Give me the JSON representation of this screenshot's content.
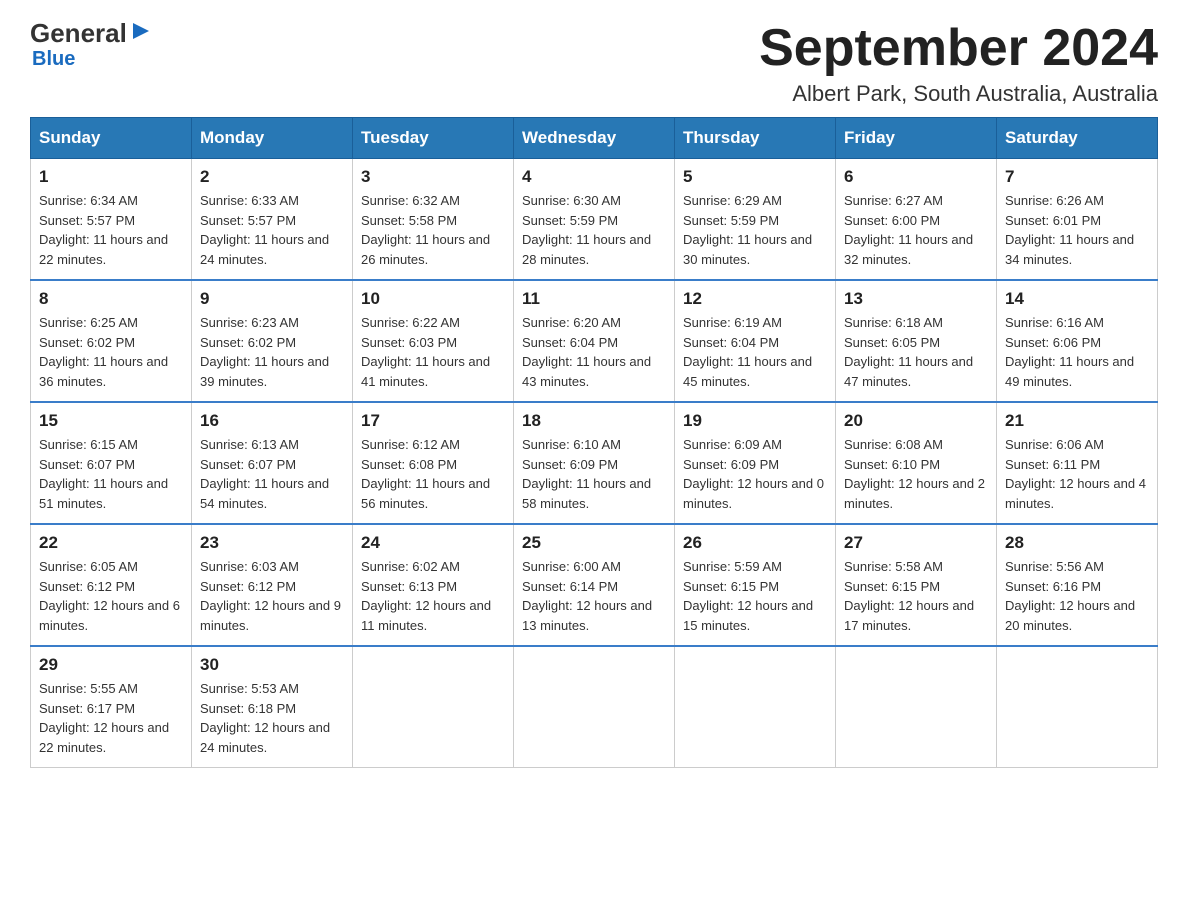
{
  "logo": {
    "general": "General",
    "blue": "Blue",
    "triangle_unicode": "▶"
  },
  "header": {
    "title": "September 2024",
    "subtitle": "Albert Park, South Australia, Australia"
  },
  "days_of_week": [
    "Sunday",
    "Monday",
    "Tuesday",
    "Wednesday",
    "Thursday",
    "Friday",
    "Saturday"
  ],
  "weeks": [
    [
      {
        "day": "1",
        "sunrise": "6:34 AM",
        "sunset": "5:57 PM",
        "daylight": "11 hours and 22 minutes."
      },
      {
        "day": "2",
        "sunrise": "6:33 AM",
        "sunset": "5:57 PM",
        "daylight": "11 hours and 24 minutes."
      },
      {
        "day": "3",
        "sunrise": "6:32 AM",
        "sunset": "5:58 PM",
        "daylight": "11 hours and 26 minutes."
      },
      {
        "day": "4",
        "sunrise": "6:30 AM",
        "sunset": "5:59 PM",
        "daylight": "11 hours and 28 minutes."
      },
      {
        "day": "5",
        "sunrise": "6:29 AM",
        "sunset": "5:59 PM",
        "daylight": "11 hours and 30 minutes."
      },
      {
        "day": "6",
        "sunrise": "6:27 AM",
        "sunset": "6:00 PM",
        "daylight": "11 hours and 32 minutes."
      },
      {
        "day": "7",
        "sunrise": "6:26 AM",
        "sunset": "6:01 PM",
        "daylight": "11 hours and 34 minutes."
      }
    ],
    [
      {
        "day": "8",
        "sunrise": "6:25 AM",
        "sunset": "6:02 PM",
        "daylight": "11 hours and 36 minutes."
      },
      {
        "day": "9",
        "sunrise": "6:23 AM",
        "sunset": "6:02 PM",
        "daylight": "11 hours and 39 minutes."
      },
      {
        "day": "10",
        "sunrise": "6:22 AM",
        "sunset": "6:03 PM",
        "daylight": "11 hours and 41 minutes."
      },
      {
        "day": "11",
        "sunrise": "6:20 AM",
        "sunset": "6:04 PM",
        "daylight": "11 hours and 43 minutes."
      },
      {
        "day": "12",
        "sunrise": "6:19 AM",
        "sunset": "6:04 PM",
        "daylight": "11 hours and 45 minutes."
      },
      {
        "day": "13",
        "sunrise": "6:18 AM",
        "sunset": "6:05 PM",
        "daylight": "11 hours and 47 minutes."
      },
      {
        "day": "14",
        "sunrise": "6:16 AM",
        "sunset": "6:06 PM",
        "daylight": "11 hours and 49 minutes."
      }
    ],
    [
      {
        "day": "15",
        "sunrise": "6:15 AM",
        "sunset": "6:07 PM",
        "daylight": "11 hours and 51 minutes."
      },
      {
        "day": "16",
        "sunrise": "6:13 AM",
        "sunset": "6:07 PM",
        "daylight": "11 hours and 54 minutes."
      },
      {
        "day": "17",
        "sunrise": "6:12 AM",
        "sunset": "6:08 PM",
        "daylight": "11 hours and 56 minutes."
      },
      {
        "day": "18",
        "sunrise": "6:10 AM",
        "sunset": "6:09 PM",
        "daylight": "11 hours and 58 minutes."
      },
      {
        "day": "19",
        "sunrise": "6:09 AM",
        "sunset": "6:09 PM",
        "daylight": "12 hours and 0 minutes."
      },
      {
        "day": "20",
        "sunrise": "6:08 AM",
        "sunset": "6:10 PM",
        "daylight": "12 hours and 2 minutes."
      },
      {
        "day": "21",
        "sunrise": "6:06 AM",
        "sunset": "6:11 PM",
        "daylight": "12 hours and 4 minutes."
      }
    ],
    [
      {
        "day": "22",
        "sunrise": "6:05 AM",
        "sunset": "6:12 PM",
        "daylight": "12 hours and 6 minutes."
      },
      {
        "day": "23",
        "sunrise": "6:03 AM",
        "sunset": "6:12 PM",
        "daylight": "12 hours and 9 minutes."
      },
      {
        "day": "24",
        "sunrise": "6:02 AM",
        "sunset": "6:13 PM",
        "daylight": "12 hours and 11 minutes."
      },
      {
        "day": "25",
        "sunrise": "6:00 AM",
        "sunset": "6:14 PM",
        "daylight": "12 hours and 13 minutes."
      },
      {
        "day": "26",
        "sunrise": "5:59 AM",
        "sunset": "6:15 PM",
        "daylight": "12 hours and 15 minutes."
      },
      {
        "day": "27",
        "sunrise": "5:58 AM",
        "sunset": "6:15 PM",
        "daylight": "12 hours and 17 minutes."
      },
      {
        "day": "28",
        "sunrise": "5:56 AM",
        "sunset": "6:16 PM",
        "daylight": "12 hours and 20 minutes."
      }
    ],
    [
      {
        "day": "29",
        "sunrise": "5:55 AM",
        "sunset": "6:17 PM",
        "daylight": "12 hours and 22 minutes."
      },
      {
        "day": "30",
        "sunrise": "5:53 AM",
        "sunset": "6:18 PM",
        "daylight": "12 hours and 24 minutes."
      },
      null,
      null,
      null,
      null,
      null
    ]
  ]
}
